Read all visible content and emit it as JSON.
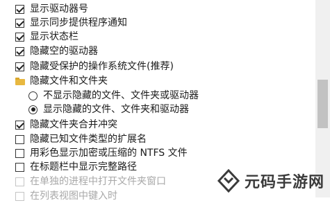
{
  "options": [
    {
      "type": "checkbox",
      "checked": true,
      "label": "显示驱动器号"
    },
    {
      "type": "checkbox",
      "checked": true,
      "label": "显示同步提供程序通知"
    },
    {
      "type": "checkbox",
      "checked": true,
      "label": "显示状态栏"
    },
    {
      "type": "checkbox",
      "checked": true,
      "label": "隐藏空的驱动器"
    },
    {
      "type": "checkbox",
      "checked": true,
      "label": "隐藏受保护的操作系统文件(推荐)"
    },
    {
      "type": "folder",
      "label": "隐藏文件和文件夹"
    },
    {
      "type": "radio",
      "checked": false,
      "label": "不显示隐藏的文件、文件夹或驱动器"
    },
    {
      "type": "radio",
      "checked": true,
      "label": "显示隐藏的文件、文件夹和驱动器"
    },
    {
      "type": "checkbox",
      "checked": true,
      "label": "隐藏文件夹合并冲突"
    },
    {
      "type": "checkbox",
      "checked": false,
      "label": "隐藏已知文件类型的扩展名"
    },
    {
      "type": "checkbox",
      "checked": false,
      "label": "用彩色显示加密或压缩的 NTFS 文件"
    },
    {
      "type": "checkbox",
      "checked": false,
      "label": "在标题栏中显示完整路径"
    },
    {
      "type": "checkbox",
      "checked": false,
      "label": "在单独的进程中打开文件夹窗口"
    },
    {
      "type": "checkbox",
      "checked": false,
      "label": "在列表视图中键入时"
    }
  ],
  "watermark": {
    "text": "元码手游网",
    "color": "#3b3b3b"
  }
}
